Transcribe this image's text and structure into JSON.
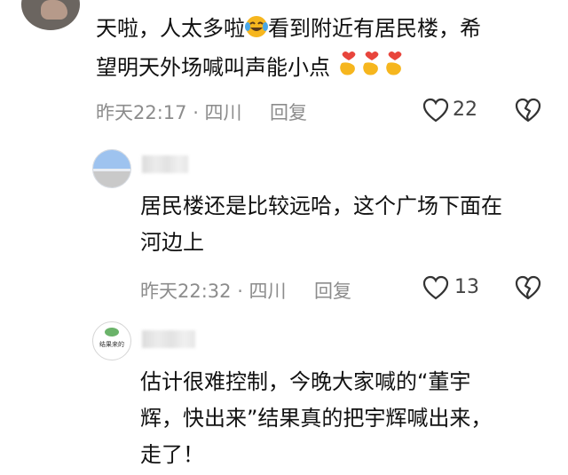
{
  "comments": [
    {
      "text_line1": "天啦，人太多啦",
      "text_line1_tail": "看到附近有居民楼，希",
      "text_line2": "望明天外场喊叫声能小点",
      "time": "昨天22:17 · 四川",
      "reply_label": "回复",
      "like_count": "22"
    },
    {
      "text_line1": "居民楼还是比较远哈，这个广场下面在",
      "text_line2": "河边上",
      "time": "昨天22:32 · 四川",
      "reply_label": "回复",
      "like_count": "13"
    },
    {
      "text_line1": "估计很难控制，今晚大家喊的“董宇",
      "text_line2": "辉，快出来”结果真的把宇辉喊出来，",
      "text_line3": "走了！",
      "avatar_logo_text": "结果来的"
    }
  ],
  "icons": {
    "laugh_emoji": "face-with-tears-of-joy-icon",
    "finger_heart": "finger-heart-icon",
    "like": "heart-outline-icon",
    "dislike": "broken-heart-outline-icon"
  },
  "colors": {
    "text": "#111111",
    "meta": "#8c8c8c",
    "emoji_yellow": "#f6b61e",
    "heart_red": "#e8453c"
  }
}
